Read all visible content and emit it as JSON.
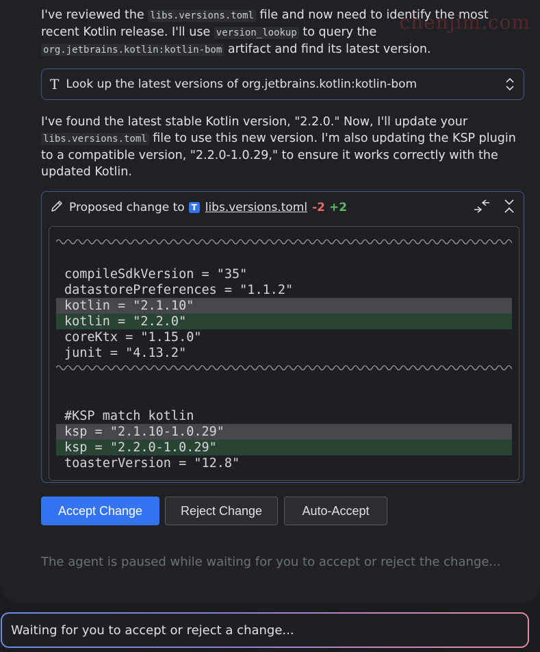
{
  "watermark": "chenjim.com",
  "message1": {
    "before_file": "I've reviewed the ",
    "file_code": "libs.versions.toml",
    "after_file": " file and now need to identify the most recent Kotlin release. I'll use ",
    "tool_code": "version_lookup",
    "after_tool": " to query the ",
    "artifact_code": "org.jetbrains.kotlin:kotlin-bom",
    "end": " artifact and find its latest version."
  },
  "tool_call": {
    "icon": "text-tool-icon",
    "label": "Look up the latest versions of org.jetbrains.kotlin:kotlin-bom"
  },
  "message2": {
    "before_file": "I've found the latest stable Kotlin version, \"2.2.0.\" Now, I'll update your ",
    "file_code": "libs.versions.toml",
    "after_file": " file to use this new version. I'm also updating the KSP plugin to a compatible version, \"2.2.0-1.0.29,\" to ensure it works correctly with the updated Kotlin."
  },
  "diff": {
    "header_prefix": "Proposed change to",
    "file_badge": "T",
    "file_name": "libs.versions.toml",
    "removed_count": "-2",
    "added_count": "+2",
    "lines": [
      {
        "text": "compileSdkVersion = \"35\"",
        "kind": "context"
      },
      {
        "text": "datastorePreferences = \"1.1.2\"",
        "kind": "context"
      },
      {
        "text": "kotlin = \"2.1.10\"",
        "kind": "removed"
      },
      {
        "text": "kotlin = \"2.2.0\"",
        "kind": "added"
      },
      {
        "text": "coreKtx = \"1.15.0\"",
        "kind": "context"
      },
      {
        "text": "junit = \"4.13.2\"",
        "kind": "context"
      },
      {
        "text": "#KSP match kotlin",
        "kind": "context"
      },
      {
        "text": "ksp = \"2.1.10-1.0.29\"",
        "kind": "removed"
      },
      {
        "text": "ksp = \"2.2.0-1.0.29\"",
        "kind": "added"
      },
      {
        "text": "toasterVersion = \"12.8\"",
        "kind": "context"
      }
    ]
  },
  "buttons": {
    "accept": "Accept Change",
    "reject": "Reject Change",
    "auto_accept": "Auto-Accept"
  },
  "paused_text": "The agent is paused while waiting for you to accept or reject the change...",
  "input": {
    "placeholder": "Waiting for you to accept or reject a change..."
  },
  "colors": {
    "accent": "#3574f0",
    "removed": "#e06c6c",
    "added": "#5fb865"
  }
}
